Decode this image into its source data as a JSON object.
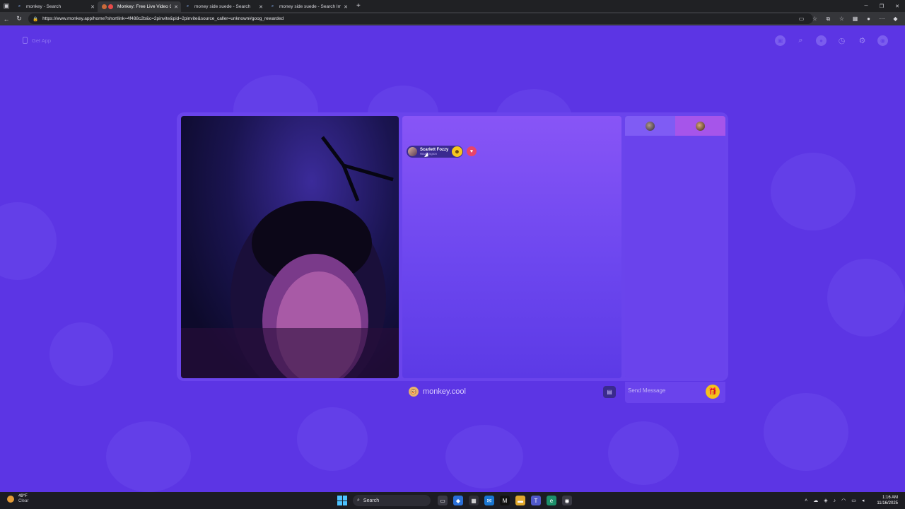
{
  "browser": {
    "tabs": [
      {
        "title": "monkey - Search",
        "active": false
      },
      {
        "title": "Monkey: Free Live Video Ch",
        "active": true
      },
      {
        "title": "money side suede - Search",
        "active": false
      },
      {
        "title": "money side suede - Search Imag",
        "active": false
      }
    ],
    "url": "https://www.monkey.app/home?shortlink=4f488c2b&c=2pinvite&pid=2pinvite&source_caller=unknown#goog_rewarded"
  },
  "page": {
    "get_app_label": "Get App",
    "top_icons": [
      "store-icon",
      "search-icon",
      "coin-icon",
      "history-icon",
      "settings-icon",
      "profile-icon"
    ],
    "partner": {
      "name": "Scarlett Fozzy",
      "location": "Washington"
    },
    "brand_text": "monkey.cool",
    "message_placeholder": "Send Message",
    "accent": "#5c35e4",
    "gift_color": "#f5c21a"
  },
  "taskbar": {
    "weather_temp": "49°F",
    "weather_cond": "Clear",
    "search_label": "Search",
    "time": "1:16 AM",
    "date": "11/16/2025"
  }
}
